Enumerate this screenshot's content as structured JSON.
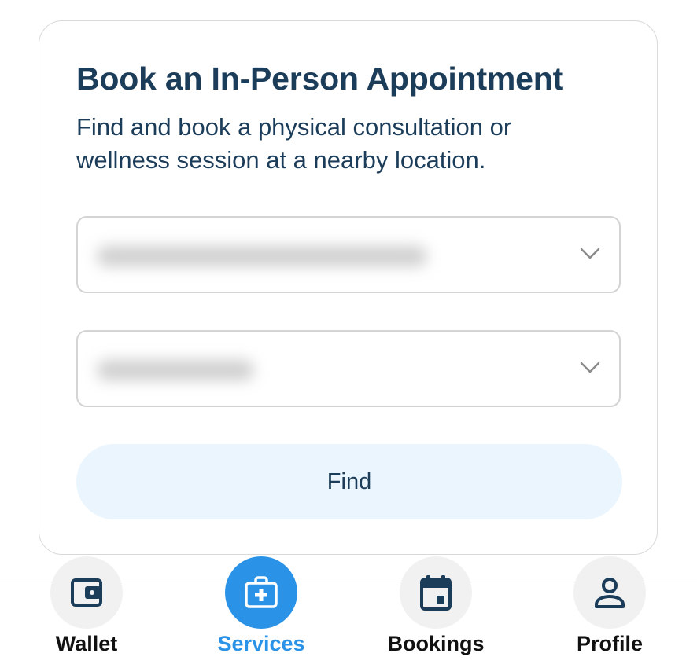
{
  "card": {
    "title": "Book an In-Person Appointment",
    "subtitle": "Find and book a physical consultation or wellness session at a nearby location."
  },
  "selects": [
    {
      "value": "",
      "icon": "chevron-down-icon"
    },
    {
      "value": "",
      "icon": "chevron-down-icon"
    }
  ],
  "find_button": {
    "label": "Find"
  },
  "bottom_nav": {
    "items": [
      {
        "label": "Wallet",
        "icon": "wallet-icon",
        "active": false
      },
      {
        "label": "Services",
        "icon": "medical-kit-icon",
        "active": true
      },
      {
        "label": "Bookings",
        "icon": "calendar-icon",
        "active": false
      },
      {
        "label": "Profile",
        "icon": "person-icon",
        "active": false
      }
    ]
  },
  "colors": {
    "primary_text": "#1c3d5a",
    "accent": "#2a93e8",
    "button_bg": "#eaf5fd"
  }
}
